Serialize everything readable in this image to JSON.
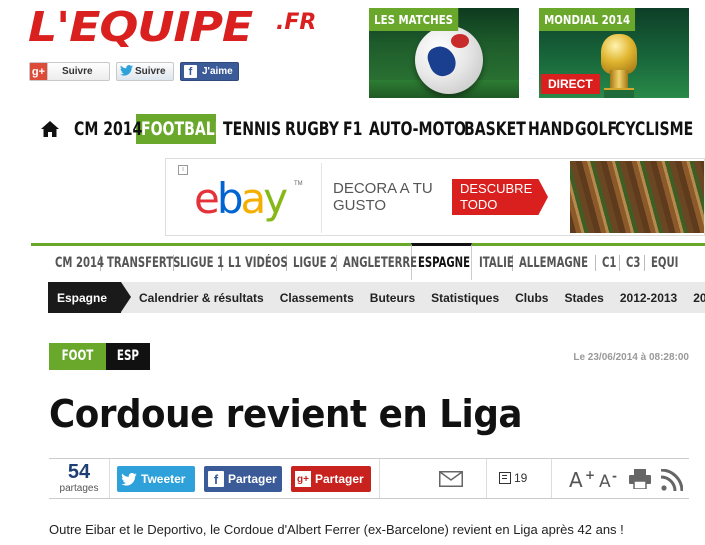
{
  "header": {
    "logo_main": "L'EQUIPE",
    "logo_suffix": ".FR",
    "social": {
      "google_icon": "g+",
      "google_label": "Suivre",
      "twitter_label": "Suivre",
      "facebook_label": "J'aime"
    },
    "promos": {
      "matches_label": "LES MATCHES",
      "mondial_label": "MONDIAL 2014",
      "mondial_badge": "DIRECT"
    }
  },
  "main_nav": {
    "home_icon": "home-icon",
    "items": [
      "CM 2014",
      "FOOTBALL",
      "TENNIS",
      "RUGBY",
      "F1",
      "AUTO-MOTO",
      "BASKET",
      "HAND",
      "GOLF",
      "CYCLISME"
    ],
    "active": "FOOTBALL"
  },
  "ad": {
    "brand": "ebay",
    "text": "DECORA A TU GUSTO",
    "cta": "DESCUBRE TODO"
  },
  "section_nav": {
    "items": [
      "CM 2014",
      "TRANSFERTS",
      "LIGUE 1",
      "L1 VIDÉOS",
      "LIGUE 2",
      "ANGLETERRE",
      "ESPAGNE",
      "ITALIE",
      "ALLEMAGNE",
      "C1",
      "C3",
      "EQUI"
    ],
    "active": "ESPAGNE"
  },
  "sub_nav": {
    "active": "Espagne",
    "items": [
      "Calendrier & résultats",
      "Classements",
      "Buteurs",
      "Statistiques",
      "Clubs",
      "Stades",
      "2012-2013",
      "20"
    ]
  },
  "article": {
    "tag_sport": "FOOT",
    "tag_country": "ESP",
    "date": "Le 23/06/2014 à 08:28:00",
    "title": "Cordoue revient en Liga",
    "share": {
      "count": "54",
      "count_label": "partages",
      "twitter": "Tweeter",
      "facebook": "Partager",
      "google": "Partager",
      "comments": "19"
    },
    "body": "Outre Eibar et le Deportivo, le Cordoue d'Albert Ferrer (ex-Barcelone) revient en Liga après 42 ans !"
  },
  "colors": {
    "brand_red": "#d9201f",
    "accent_green": "#6aa82b",
    "dark": "#111111"
  }
}
